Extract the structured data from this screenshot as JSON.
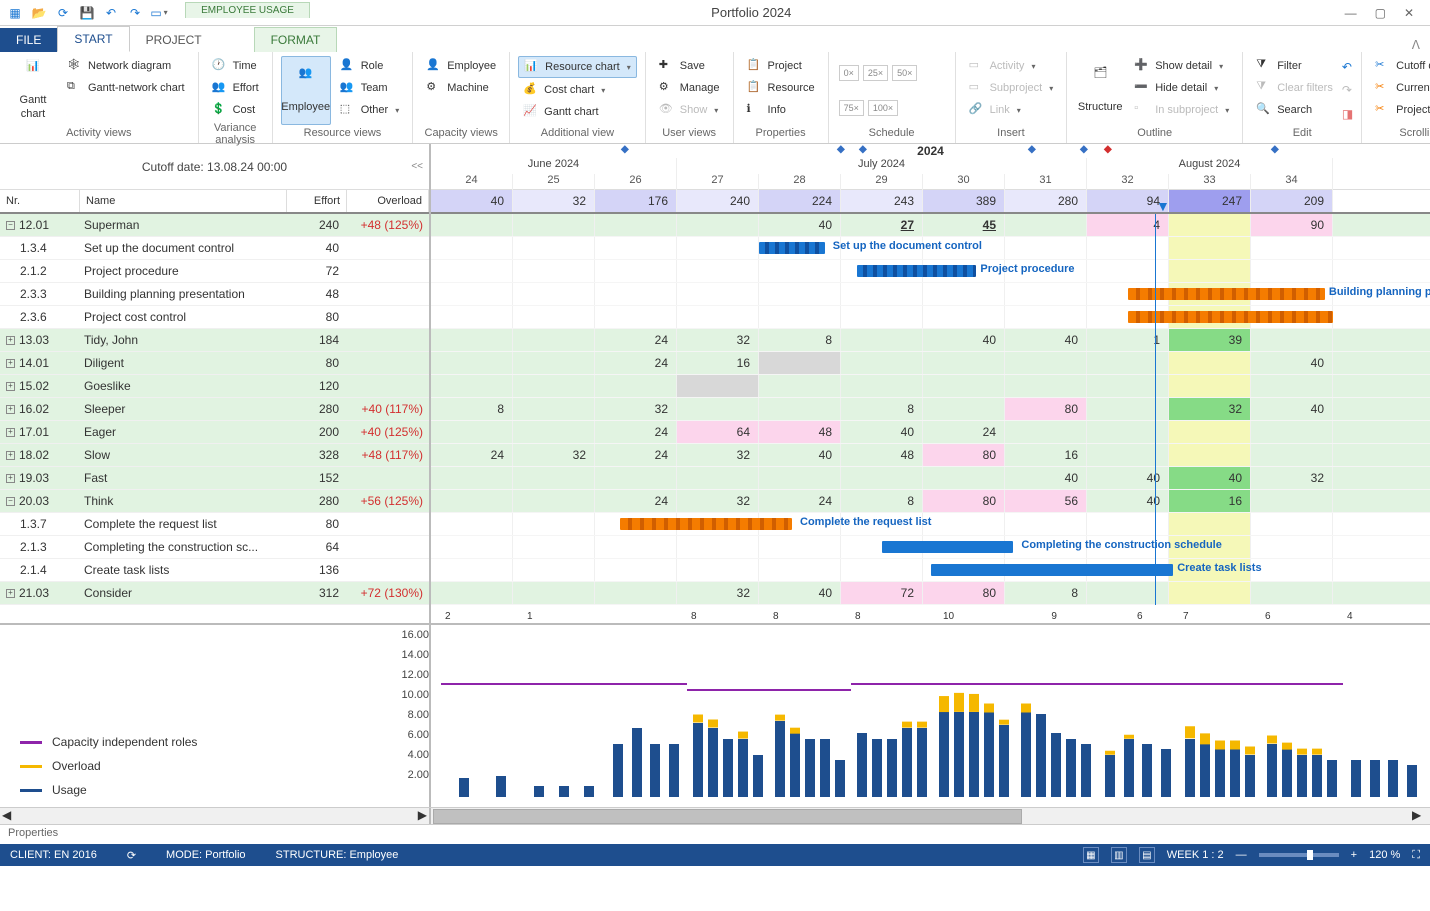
{
  "window": {
    "title": "Portfolio 2024"
  },
  "context_tab": "EMPLOYEE USAGE",
  "tabs": {
    "file": "FILE",
    "start": "START",
    "project": "PROJECT",
    "format": "FORMAT"
  },
  "ribbon": {
    "activity_views": {
      "label": "Activity views",
      "gantt_chart": "Gantt\nchart",
      "network_diagram": "Network diagram",
      "gantt_network": "Gantt-network chart"
    },
    "variance": {
      "label": "Variance analysis",
      "time": "Time",
      "effort": "Effort",
      "cost": "Cost"
    },
    "resource_views": {
      "label": "Resource views",
      "employee": "Employee",
      "role": "Role",
      "team": "Team",
      "other": "Other"
    },
    "capacity_views": {
      "label": "Capacity views",
      "employee": "Employee",
      "machine": "Machine"
    },
    "additional": {
      "label": "Additional view",
      "resource_chart": "Resource chart",
      "cost_chart": "Cost chart",
      "gantt_chart": "Gantt chart"
    },
    "user_views": {
      "label": "User views",
      "save": "Save",
      "manage": "Manage",
      "show": "Show"
    },
    "properties": {
      "label": "Properties",
      "project": "Project",
      "resource": "Resource",
      "info": "Info"
    },
    "schedule": {
      "label": "Schedule",
      "zero": "0×",
      "q": "25×",
      "h": "50×",
      "tq": "75×",
      "f": "100×"
    },
    "insert": {
      "label": "Insert",
      "activity": "Activity",
      "subproject": "Subproject",
      "link": "Link"
    },
    "outline": {
      "label": "Outline",
      "structure": "Structure",
      "show_detail": "Show detail",
      "hide_detail": "Hide detail",
      "in_subproject": "In subproject"
    },
    "edit": {
      "label": "Edit",
      "filter": "Filter",
      "clear_filters": "Clear filters",
      "search": "Search"
    },
    "scrolling": {
      "label": "Scrolling",
      "cutoff_date": "Cutoff date",
      "current_date": "Current date",
      "project_start": "Project start"
    }
  },
  "cutoff_date_label": "Cutoff date: 13.08.24 00:00",
  "columns": {
    "nr": "Nr.",
    "name": "Name",
    "effort": "Effort",
    "overload": "Overload"
  },
  "timeline": {
    "year": "2024",
    "months": [
      "June 2024",
      "July 2024",
      "August 2024"
    ],
    "weeks": [
      "24",
      "25",
      "26",
      "27",
      "28",
      "29",
      "30",
      "31",
      "32",
      "33",
      "34"
    ],
    "totals": [
      "40",
      "32",
      "176",
      "240",
      "224",
      "243",
      "389",
      "280",
      "94",
      "247",
      "209"
    ],
    "cutoff_week_index": 9
  },
  "rows": [
    {
      "type": "group",
      "expand": "minus",
      "nr": "12.01",
      "name": "Superman",
      "effort": "240",
      "overload": "+48 (125%)",
      "cells": [
        "",
        "",
        "",
        "",
        "40",
        "27",
        "45",
        "",
        "4",
        "",
        "90"
      ],
      "colors": [
        "",
        "",
        "",
        "",
        "",
        "",
        "",
        "",
        "pink",
        "",
        "pink"
      ],
      "underline": [
        false,
        false,
        false,
        false,
        false,
        true,
        true,
        false,
        false,
        false,
        false
      ]
    },
    {
      "type": "task",
      "nr": "1.3.4",
      "name": "Set up the document control",
      "effort": "40",
      "bar": {
        "color": "blue-striped",
        "start": 4.0,
        "end": 4.8,
        "label": "Set up the document control",
        "label_at": 4.9
      }
    },
    {
      "type": "task",
      "nr": "2.1.2",
      "name": "Project procedure",
      "effort": "72",
      "bar": {
        "color": "blue-striped",
        "start": 5.2,
        "end": 6.65,
        "label": "Project procedure",
        "label_at": 6.7
      }
    },
    {
      "type": "task",
      "nr": "2.3.3",
      "name": "Building planning presentation",
      "effort": "48",
      "bar": {
        "color": "orange",
        "start": 8.5,
        "end": 10.9,
        "label": "Building planning presentation",
        "label_at": 10.95
      }
    },
    {
      "type": "task",
      "nr": "2.3.6",
      "name": "Project cost control",
      "effort": "80",
      "bar": {
        "color": "orange",
        "start": 8.5,
        "end": 11.0
      }
    },
    {
      "type": "group",
      "expand": "plus",
      "nr": "13.03",
      "name": "Tidy, John",
      "effort": "184",
      "overload": "",
      "cells": [
        "",
        "",
        "24",
        "32",
        "8",
        "",
        "40",
        "40",
        "1",
        "39",
        ""
      ],
      "colors": [
        "",
        "",
        "",
        "",
        "",
        "",
        "",
        "",
        "",
        "dgreen",
        ""
      ]
    },
    {
      "type": "group",
      "expand": "plus",
      "nr": "14.01",
      "name": "Diligent",
      "effort": "80",
      "overload": "",
      "cells": [
        "",
        "",
        "24",
        "16",
        "",
        "",
        "",
        "",
        "",
        "",
        "40"
      ],
      "colors": [
        "",
        "",
        "",
        "",
        "grey",
        "",
        "",
        "",
        "",
        "",
        ""
      ]
    },
    {
      "type": "group",
      "expand": "plus",
      "nr": "15.02",
      "name": "Goeslike",
      "effort": "120",
      "overload": "",
      "cells": [
        "",
        "",
        "",
        "",
        "",
        "",
        "",
        "",
        "",
        "",
        ""
      ],
      "colors": [
        "",
        "",
        "",
        "grey",
        "",
        "",
        "",
        "",
        "",
        "",
        ""
      ]
    },
    {
      "type": "group",
      "expand": "plus",
      "nr": "16.02",
      "name": "Sleeper",
      "effort": "280",
      "overload": "+40 (117%)",
      "cells": [
        "8",
        "",
        "32",
        "",
        "",
        "8",
        "",
        "80",
        "",
        "32",
        "40"
      ],
      "colors": [
        "",
        "",
        "",
        "",
        "",
        "",
        "",
        "pink",
        "",
        "dgreen",
        ""
      ]
    },
    {
      "type": "group",
      "expand": "plus",
      "nr": "17.01",
      "name": "Eager",
      "effort": "200",
      "overload": "+40 (125%)",
      "cells": [
        "",
        "",
        "24",
        "64",
        "48",
        "40",
        "24",
        "",
        "",
        "",
        ""
      ],
      "colors": [
        "",
        "",
        "",
        "pink",
        "pink",
        "",
        "",
        "",
        "",
        "",
        ""
      ]
    },
    {
      "type": "group",
      "expand": "plus",
      "nr": "18.02",
      "name": "Slow",
      "effort": "328",
      "overload": "+48 (117%)",
      "cells": [
        "24",
        "32",
        "24",
        "32",
        "40",
        "48",
        "80",
        "16",
        "",
        "",
        ""
      ],
      "colors": [
        "",
        "",
        "",
        "",
        "",
        "",
        "pink",
        "",
        "",
        "",
        ""
      ]
    },
    {
      "type": "group",
      "expand": "plus",
      "nr": "19.03",
      "name": "Fast",
      "effort": "152",
      "overload": "",
      "cells": [
        "",
        "",
        "",
        "",
        "",
        "",
        "",
        "40",
        "40",
        "40",
        "32"
      ],
      "colors": [
        "",
        "",
        "",
        "",
        "",
        "",
        "",
        "",
        "",
        "dgreen",
        ""
      ]
    },
    {
      "type": "group",
      "expand": "minus",
      "nr": "20.03",
      "name": "Think",
      "effort": "280",
      "overload": "+56 (125%)",
      "cells": [
        "",
        "",
        "24",
        "32",
        "24",
        "8",
        "80",
        "56",
        "40",
        "16",
        ""
      ],
      "colors": [
        "",
        "",
        "",
        "",
        "",
        "",
        "pink",
        "pink",
        "",
        "dgreen",
        ""
      ]
    },
    {
      "type": "task",
      "nr": "1.3.7",
      "name": "Complete the request list",
      "effort": "80",
      "bar": {
        "color": "orange",
        "start": 2.3,
        "end": 4.4,
        "label": "Complete the request list",
        "label_at": 4.5
      }
    },
    {
      "type": "task",
      "nr": "2.1.3",
      "name": "Completing the construction sc...",
      "effort": "64",
      "bar": {
        "color": "blue",
        "start": 5.5,
        "end": 7.1,
        "label": "Completing the construction schedule",
        "label_at": 7.2
      }
    },
    {
      "type": "task",
      "nr": "2.1.4",
      "name": "Create task lists",
      "effort": "136",
      "bar": {
        "color": "blue",
        "start": 6.1,
        "end": 9.05,
        "label": "Create task lists",
        "label_at": 9.1
      }
    },
    {
      "type": "group",
      "expand": "plus",
      "nr": "21.03",
      "name": "Consider",
      "effort": "312",
      "overload": "+72 (130%)",
      "cells": [
        "",
        "",
        "",
        "32",
        "40",
        "72",
        "80",
        "8",
        "",
        "",
        ""
      ],
      "colors": [
        "",
        "",
        "",
        "",
        "",
        "pink",
        "pink",
        "",
        "",
        "",
        ""
      ]
    }
  ],
  "chart_data": {
    "type": "bar",
    "title": "",
    "ylabel": "",
    "ylim": [
      0,
      16
    ],
    "yticks": [
      "16.00",
      "14.00",
      "12.00",
      "10.00",
      "8.00",
      "6.00",
      "4.00",
      "2.00"
    ],
    "capacity_segments": [
      {
        "from_week": 0,
        "to_week": 3,
        "value": 10.5
      },
      {
        "from_week": 3,
        "to_week": 5,
        "value": 10
      },
      {
        "from_week": 5,
        "to_week": 11,
        "value": 10.5
      }
    ],
    "legend": {
      "capacity": "Capacity independent roles",
      "overload": "Overload",
      "usage": "Usage"
    },
    "week_labels": [
      "2",
      "1",
      "",
      "8",
      "8",
      "8",
      "10",
      "9",
      "6",
      "7",
      "6",
      "4"
    ],
    "label_positions": [
      0,
      0,
      0,
      0,
      0,
      0,
      0.5,
      2.7,
      3,
      0,
      0,
      0
    ],
    "series_per_week": [
      [
        {
          "u": 1.8
        },
        {
          "u": 2
        }
      ],
      [
        {
          "u": 1
        },
        {
          "u": 1
        },
        {
          "u": 1
        }
      ],
      [
        {
          "u": 5
        },
        {
          "u": 6.5
        },
        {
          "u": 5
        },
        {
          "u": 5
        }
      ],
      [
        {
          "u": 7,
          "o": 0.8
        },
        {
          "u": 6.5,
          "o": 0.8
        },
        {
          "u": 5.5
        },
        {
          "u": 5.5,
          "o": 0.7
        },
        {
          "u": 4
        }
      ],
      [
        {
          "u": 7.2,
          "o": 0.6
        },
        {
          "u": 6,
          "o": 0.5
        },
        {
          "u": 5.5
        },
        {
          "u": 5.5
        },
        {
          "u": 3.5
        }
      ],
      [
        {
          "u": 6
        },
        {
          "u": 5.5
        },
        {
          "u": 5.5
        },
        {
          "u": 6.5,
          "o": 0.6
        },
        {
          "u": 6.5,
          "o": 0.6
        }
      ],
      [
        {
          "u": 8,
          "o": 1.5
        },
        {
          "u": 8,
          "o": 1.8
        },
        {
          "u": 8,
          "o": 1.7
        },
        {
          "u": 8,
          "o": 0.8
        },
        {
          "u": 6.8,
          "o": 0.5
        }
      ],
      [
        {
          "u": 8,
          "o": 0.8
        },
        {
          "u": 7.8
        },
        {
          "u": 6
        },
        {
          "u": 5.5
        },
        {
          "u": 5
        }
      ],
      [
        {
          "u": 4,
          "o": 0.4
        },
        {
          "u": 5.5,
          "o": 0.4
        },
        {
          "u": 5
        },
        {
          "u": 4.5
        }
      ],
      [
        {
          "u": 5.5,
          "o": 1.2
        },
        {
          "u": 5,
          "o": 1
        },
        {
          "u": 4.5,
          "o": 0.8
        },
        {
          "u": 4.5,
          "o": 0.8
        },
        {
          "u": 4,
          "o": 0.8
        }
      ],
      [
        {
          "u": 5,
          "o": 0.8
        },
        {
          "u": 4.5,
          "o": 0.6
        },
        {
          "u": 4,
          "o": 0.6
        },
        {
          "u": 4,
          "o": 0.6
        },
        {
          "u": 3.5
        }
      ],
      [
        {
          "u": 3.5
        },
        {
          "u": 3.5
        },
        {
          "u": 3.5
        },
        {
          "u": 3
        }
      ]
    ]
  },
  "props_label": "Properties",
  "status": {
    "client": "CLIENT: EN 2016",
    "mode": "MODE: Portfolio",
    "structure": "STRUCTURE: Employee",
    "week": "WEEK 1 : 2",
    "zoom": "120 %"
  }
}
